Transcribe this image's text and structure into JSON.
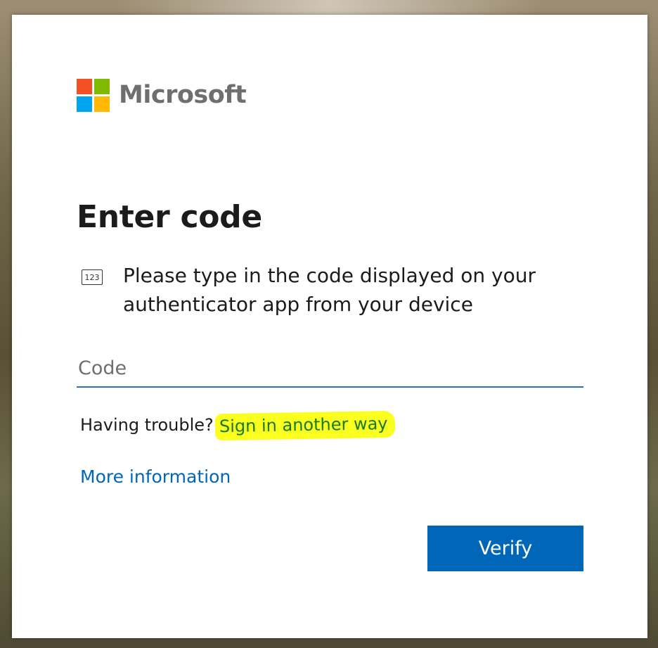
{
  "brand": {
    "name": "Microsoft",
    "logo_colors": [
      "#f25022",
      "#7fba00",
      "#00a4ef",
      "#ffb900"
    ]
  },
  "page": {
    "title": "Enter code",
    "instruction": "Please type in the code displayed on your authenticator app from your device",
    "instruction_icon": "keypad-code-icon",
    "instruction_icon_text": "123"
  },
  "form": {
    "code_placeholder": "Code",
    "code_value": ""
  },
  "help": {
    "trouble_text": "Having trouble?",
    "signin_another_way": "Sign in another way",
    "more_information": "More information"
  },
  "actions": {
    "verify_label": "Verify"
  },
  "colors": {
    "accent": "#0067b8",
    "highlight": "#fbff1f",
    "link_highlighted": "#1a7a20"
  }
}
